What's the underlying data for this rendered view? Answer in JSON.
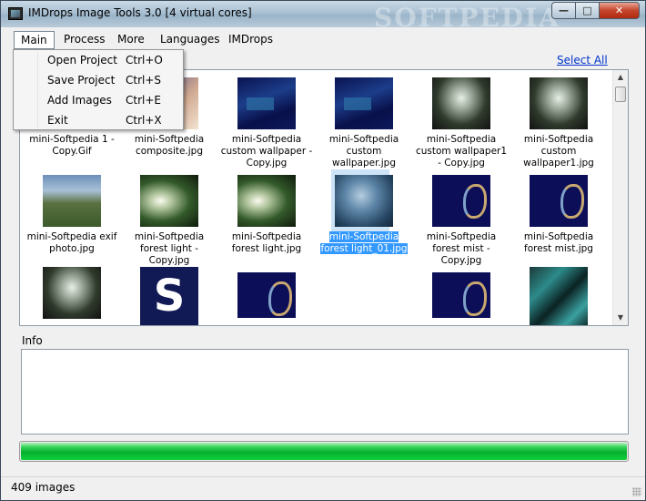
{
  "window": {
    "title": "IMDrops Image Tools 3.0 [4 virtual cores]",
    "watermark": "SOFTPEDIA"
  },
  "menubar": {
    "items": [
      "Main",
      "Process",
      "More",
      "Languages",
      "IMDrops"
    ]
  },
  "main_menu": {
    "items": [
      {
        "label": "Open Project",
        "shortcut": "Ctrl+O"
      },
      {
        "label": "Save Project",
        "shortcut": "Ctrl+S"
      },
      {
        "label": "Add Images",
        "shortcut": "Ctrl+E"
      },
      {
        "label": "Exit",
        "shortcut": "Ctrl+X"
      }
    ]
  },
  "toolbar": {
    "select_all": "Select All"
  },
  "thumbnails": [
    {
      "caption": "mini-Softpedia 1 - Copy.Gif",
      "icon": "image-partial"
    },
    {
      "caption": "mini-Softpedia composite.jpg",
      "icon": "image-composite"
    },
    {
      "caption": "mini-Softpedia custom wallpaper - Copy.jpg",
      "icon": "image-blue"
    },
    {
      "caption": "mini-Softpedia custom wallpaper.jpg",
      "icon": "image-blue"
    },
    {
      "caption": "mini-Softpedia custom wallpaper1 - Copy.jpg",
      "icon": "image-forest"
    },
    {
      "caption": "mini-Softpedia custom wallpaper1.jpg",
      "icon": "image-forest"
    },
    {
      "caption": "mini-Softpedia exif photo.jpg",
      "icon": "image-photo"
    },
    {
      "caption": "mini-Softpedia forest light - Copy.jpg",
      "icon": "image-forest-light"
    },
    {
      "caption": "mini-Softpedia forest light.jpg",
      "icon": "image-forest-light"
    },
    {
      "caption": "mini-Softpedia forest light_01.jpg",
      "icon": "image-forest-blue",
      "selected": true
    },
    {
      "caption": "mini-Softpedia forest mist - Copy.jpg",
      "icon": "image-mist"
    },
    {
      "caption": "mini-Softpedia forest mist.jpg",
      "icon": "image-mist"
    },
    {
      "caption": "",
      "icon": "image-forest"
    },
    {
      "caption": "",
      "icon": "image-s-logo",
      "text": "S"
    },
    {
      "caption": "",
      "icon": "image-mist"
    },
    {
      "caption": "",
      "icon": ""
    },
    {
      "caption": "",
      "icon": "image-mist"
    },
    {
      "caption": "",
      "icon": "image-aqua"
    }
  ],
  "info": {
    "label": "Info",
    "text": ""
  },
  "progress": {
    "fraction": 1.0,
    "color": "#06b02e"
  },
  "status": {
    "text": "409 images"
  }
}
